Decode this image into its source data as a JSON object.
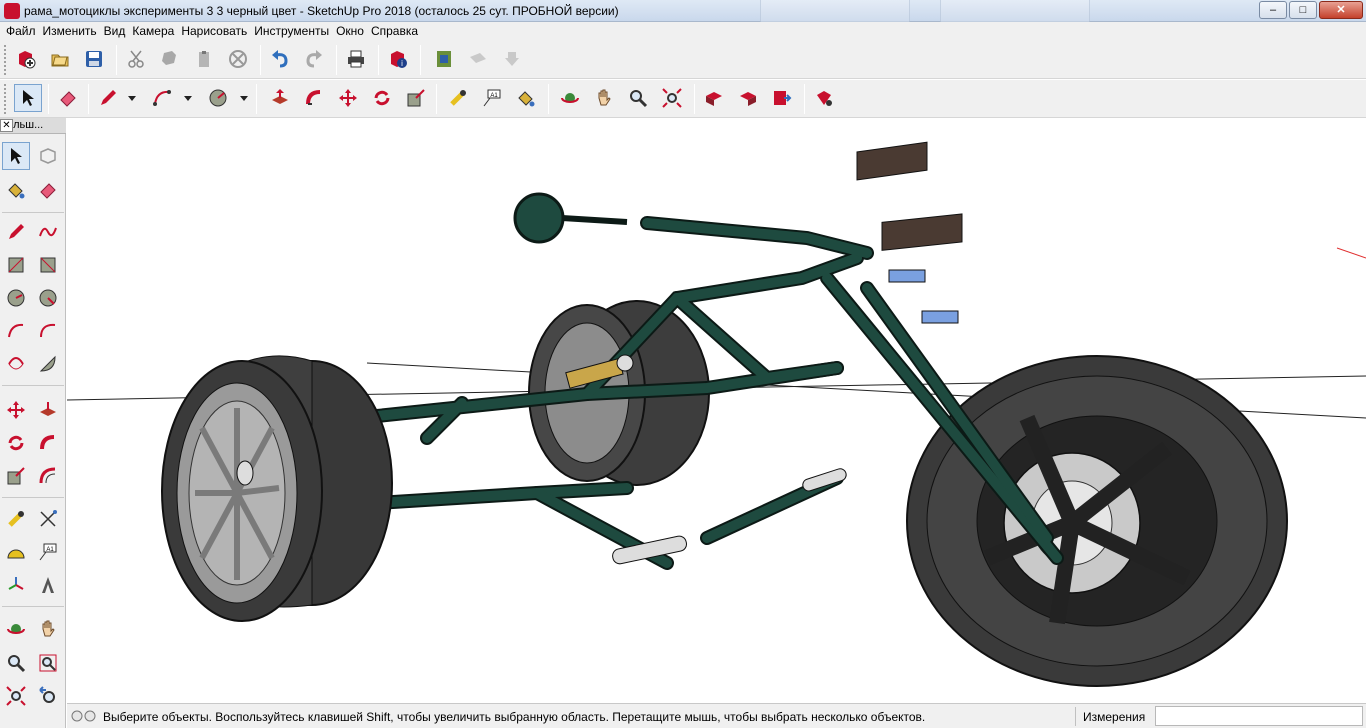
{
  "window": {
    "title": "рама_мотоциклы эксперименты 3 3  черный цвет - SketchUp Pro 2018 (осталось 25 сут. ПРОБНОЙ версии)",
    "minimize": "–",
    "maximize": "□",
    "close": "✕"
  },
  "menu": [
    {
      "label": "Файл"
    },
    {
      "label": "Изменить"
    },
    {
      "label": "Вид"
    },
    {
      "label": "Камера"
    },
    {
      "label": "Нарисовать"
    },
    {
      "label": "Инструменты"
    },
    {
      "label": "Окно"
    },
    {
      "label": "Справка"
    }
  ],
  "tray": {
    "title": "Больш...",
    "close": "✕"
  },
  "status": {
    "message": "Выберите объекты. Воспользуйтесь клавишей Shift, чтобы увеличить выбранную область. Перетащите мышь, чтобы выбрать несколько объектов.",
    "measurements_label": "Измерения",
    "measurements_value": ""
  },
  "colors": {
    "frame": "#1e4a3f",
    "tire": "#3a3a3a",
    "rim": "#9b9b9b",
    "brand": "#c8102e"
  }
}
